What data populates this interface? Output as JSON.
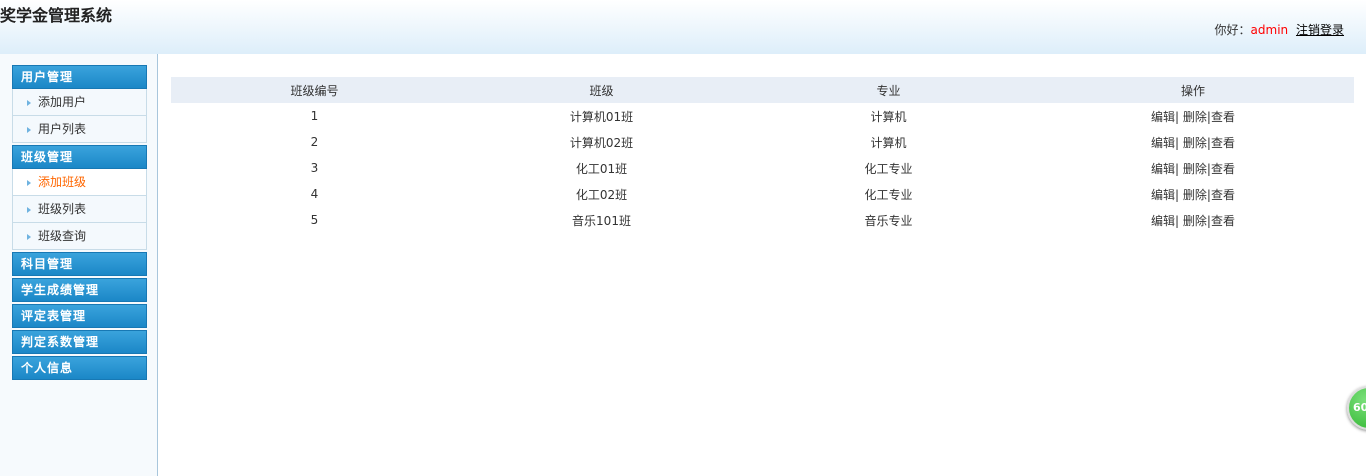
{
  "header": {
    "title": "奖学金管理系统",
    "greeting": "你好：",
    "user": "admin",
    "logout": "注销登录"
  },
  "sidebar": {
    "groups": [
      {
        "label": "用户管理",
        "items": [
          {
            "label": "添加用户"
          },
          {
            "label": "用户列表"
          }
        ]
      },
      {
        "label": "班级管理",
        "items": [
          {
            "label": "添加班级",
            "active": true
          },
          {
            "label": "班级列表"
          },
          {
            "label": "班级查询"
          }
        ]
      },
      {
        "label": "科目管理"
      },
      {
        "label": "学生成绩管理"
      },
      {
        "label": "评定表管理"
      },
      {
        "label": "判定系数管理"
      },
      {
        "label": "个人信息"
      }
    ]
  },
  "table": {
    "headers": [
      "班级编号",
      "班级",
      "专业",
      "操作"
    ],
    "rows": [
      [
        "1",
        "计算机01班",
        "计算机"
      ],
      [
        "2",
        "计算机02班",
        "计算机"
      ],
      [
        "3",
        "化工01班",
        "化工专业"
      ],
      [
        "4",
        "化工02班",
        "化工专业"
      ],
      [
        "5",
        "音乐101班",
        "音乐专业"
      ]
    ],
    "actions": {
      "edit": "编辑|",
      "delete": "删除|",
      "view": "查看"
    }
  },
  "badge": {
    "text": "60"
  }
}
